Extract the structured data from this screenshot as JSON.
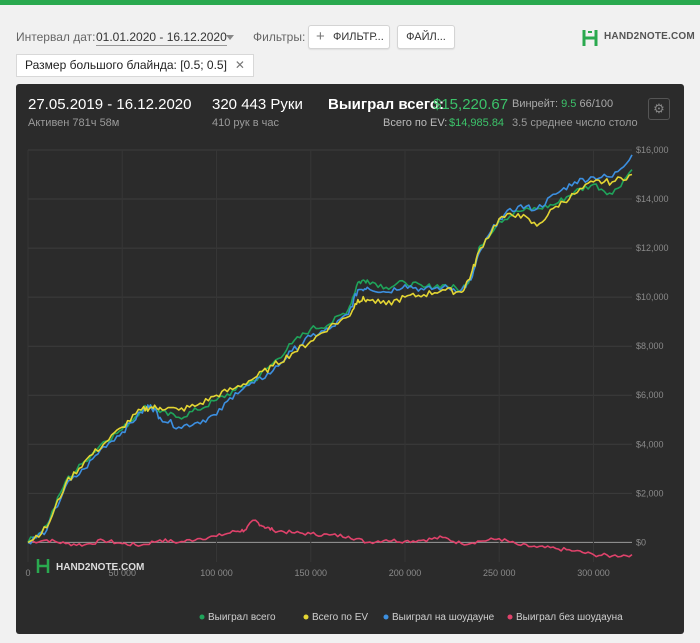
{
  "filters": {
    "interval_label": "Интервал дат:",
    "interval_value": "01.01.2020 - 16.12.2020",
    "filters_label": "Фильтры:",
    "filter_button": "ФИЛЬТР...",
    "files_button": "ФАЙЛ...",
    "chip_label": "Размер большого блайнда: [0.5; 0.5]",
    "chip_close": "✕"
  },
  "brand": {
    "logo_text": "HAND2NOTE.COM",
    "brand_color": "#2aa94f"
  },
  "stats": {
    "date_range": "27.05.2019 - 16.12.2020",
    "active": "Активен 781ч 58м",
    "hands": "320 443 Руки",
    "hands_per_hour": "410 рук в час",
    "won_label": "Выиграл всего:",
    "won_value": "$15,220.67",
    "ev_label": "Всего по EV:",
    "ev_value": "$14,985.84",
    "winrate_label": "Винрейт:",
    "winrate_value": "9.5",
    "winrate_suffix": "66/100",
    "tables": "3.5 среднее число столо"
  },
  "chart_data": {
    "type": "line",
    "xlabel": "",
    "ylabel": "",
    "x_ticks": [
      "0",
      "50 000",
      "100 000",
      "150 000",
      "200 000",
      "250 000",
      "300 000"
    ],
    "y_ticks": [
      "$0",
      "$2,000",
      "$4,000",
      "$6,000",
      "$8,000",
      "$10,000",
      "$12,000",
      "$14,000",
      "$16,000"
    ],
    "xlim": [
      0,
      320443
    ],
    "ylim": [
      -800,
      16000
    ],
    "grid": true,
    "legend_position": "bottom",
    "watermark": "HAND2NOTE.COM",
    "series": [
      {
        "name": "Выиграл всего",
        "color": "#1fa35a",
        "x": [
          0,
          10000,
          20000,
          30000,
          40000,
          50000,
          60000,
          65000,
          70000,
          80000,
          90000,
          100000,
          110000,
          120000,
          130000,
          140000,
          150000,
          160000,
          170000,
          175000,
          180000,
          190000,
          200000,
          210000,
          220000,
          230000,
          235000,
          240000,
          250000,
          260000,
          270000,
          280000,
          290000,
          300000,
          310000,
          320443
        ],
        "y": [
          0,
          700,
          2500,
          3300,
          4100,
          4600,
          5400,
          5600,
          5300,
          5100,
          5400,
          5800,
          6200,
          6600,
          7300,
          8100,
          8700,
          8900,
          9500,
          10600,
          10700,
          10400,
          10600,
          10400,
          10500,
          10300,
          10800,
          12100,
          13100,
          13500,
          13600,
          13800,
          14300,
          14600,
          14200,
          15200
        ]
      },
      {
        "name": "Всего по EV",
        "color": "#e3d533",
        "x": [
          0,
          10000,
          20000,
          30000,
          40000,
          50000,
          60000,
          65000,
          70000,
          80000,
          90000,
          100000,
          110000,
          120000,
          130000,
          140000,
          150000,
          160000,
          170000,
          175000,
          180000,
          190000,
          200000,
          210000,
          220000,
          230000,
          235000,
          240000,
          250000,
          260000,
          270000,
          280000,
          290000,
          300000,
          310000,
          320443
        ],
        "y": [
          0,
          600,
          2400,
          3300,
          4000,
          4700,
          5400,
          5500,
          5500,
          5400,
          5600,
          6000,
          6300,
          6700,
          7200,
          7700,
          8200,
          8800,
          9200,
          9900,
          9900,
          9700,
          10000,
          10100,
          10300,
          10200,
          10900,
          12000,
          13200,
          13400,
          12900,
          13700,
          14200,
          14700,
          14700,
          15000
        ]
      },
      {
        "name": "Выиграл на шоудауне",
        "color": "#3c8fe0",
        "x": [
          0,
          10000,
          20000,
          30000,
          40000,
          50000,
          60000,
          65000,
          70000,
          80000,
          90000,
          100000,
          110000,
          120000,
          130000,
          140000,
          150000,
          160000,
          170000,
          175000,
          180000,
          190000,
          200000,
          210000,
          220000,
          230000,
          235000,
          240000,
          250000,
          260000,
          270000,
          280000,
          290000,
          300000,
          310000,
          320443
        ],
        "y": [
          0,
          500,
          2300,
          3000,
          3900,
          4500,
          5300,
          5600,
          5100,
          4700,
          4900,
          5200,
          6100,
          6500,
          7000,
          7800,
          8400,
          8700,
          9300,
          10300,
          10400,
          10200,
          10500,
          10300,
          10400,
          10300,
          10700,
          11900,
          13200,
          13700,
          13600,
          14200,
          14700,
          14900,
          14900,
          15800
        ]
      },
      {
        "name": "Выиграл без шоудауна",
        "color": "#e0426b",
        "x": [
          0,
          10000,
          20000,
          30000,
          40000,
          50000,
          60000,
          70000,
          80000,
          90000,
          100000,
          110000,
          115000,
          120000,
          125000,
          130000,
          140000,
          150000,
          160000,
          170000,
          180000,
          190000,
          200000,
          210000,
          220000,
          230000,
          240000,
          250000,
          260000,
          270000,
          280000,
          290000,
          300000,
          310000,
          320443
        ],
        "y": [
          0,
          100,
          -50,
          -100,
          80,
          -50,
          -120,
          100,
          0,
          150,
          250,
          450,
          500,
          900,
          650,
          500,
          400,
          350,
          300,
          250,
          0,
          100,
          50,
          100,
          200,
          -50,
          50,
          150,
          -100,
          -200,
          -250,
          -350,
          -500,
          -550,
          -500
        ]
      }
    ]
  }
}
